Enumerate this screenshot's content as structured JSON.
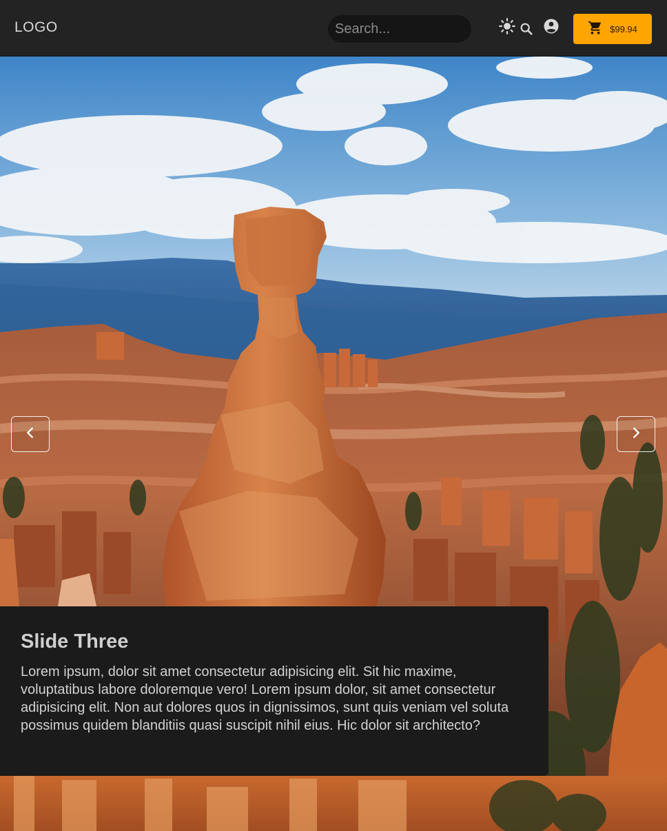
{
  "header": {
    "logo": "LOGO",
    "search": {
      "placeholder": "Search...",
      "value": ""
    },
    "theme_icon": "sun-icon",
    "account_icon": "account-circle-icon",
    "cart": {
      "icon": "cart-icon",
      "total": "$99.94"
    },
    "colors": {
      "header_bg": "#232323",
      "cart_accent": "#ffa500"
    }
  },
  "carousel": {
    "prev_icon": "chevron-left-icon",
    "next_icon": "chevron-right-icon",
    "slide": {
      "image": "rock-hoodoo-canyon-landscape",
      "title": "Slide Three",
      "text": "Lorem ipsum, dolor sit amet consectetur adipisicing elit. Sit hic maxime, voluptatibus labore doloremque vero! Lorem ipsum dolor, sit amet consectetur adipisicing elit. Non aut dolores quos in dignissimos, sunt quis veniam vel soluta possimus quidem blanditiis quasi suscipit nihil eius. Hic dolor sit architecto?"
    }
  }
}
